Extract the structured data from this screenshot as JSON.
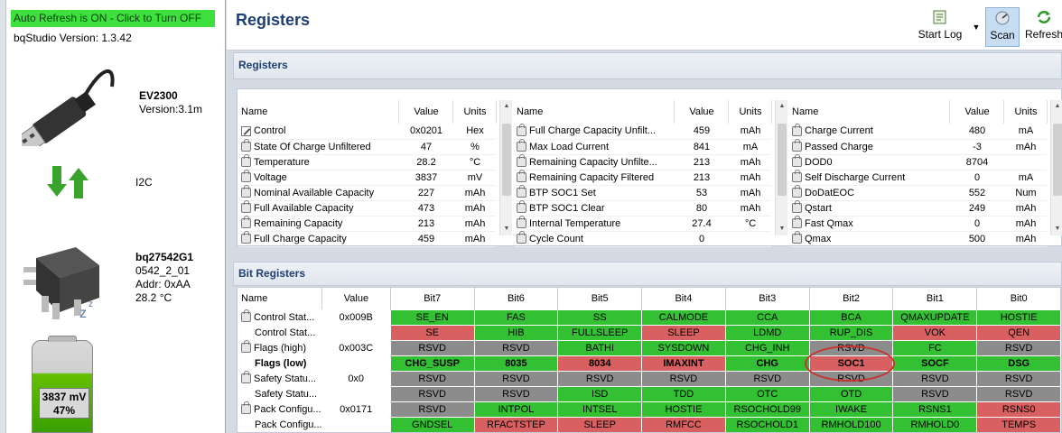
{
  "left_panel": {
    "auto_refresh": "Auto Refresh is ON - Click to Turn OFF",
    "version": "bqStudio Version:  1.3.42",
    "adapter": {
      "name": "EV2300",
      "version": "Version:3.1m"
    },
    "bus": "I2C",
    "device": {
      "name": "bq27542G1",
      "fw": "0542_2_01",
      "addr": "Addr: 0xAA",
      "temp": "28.2 °C"
    },
    "battery": {
      "voltage": "3837 mV",
      "percent": "47%"
    }
  },
  "header": {
    "title": "Registers",
    "start_log": "Start Log",
    "scan": "Scan",
    "refresh": "Refresh"
  },
  "registers": {
    "section_title": "Registers",
    "columns": [
      "Name",
      "Value",
      "Units"
    ],
    "col1": [
      {
        "name": "Control",
        "value": "0x0201",
        "units": "Hex"
      },
      {
        "name": "State Of Charge Unfiltered",
        "value": "47",
        "units": "%"
      },
      {
        "name": "Temperature",
        "value": "28.2",
        "units": "°C"
      },
      {
        "name": "Voltage",
        "value": "3837",
        "units": "mV"
      },
      {
        "name": "Nominal Available Capacity",
        "value": "227",
        "units": "mAh"
      },
      {
        "name": "Full Available Capacity",
        "value": "473",
        "units": "mAh"
      },
      {
        "name": "Remaining Capacity",
        "value": "213",
        "units": "mAh"
      },
      {
        "name": "Full Charge Capacity",
        "value": "459",
        "units": "mAh"
      }
    ],
    "col2": [
      {
        "name": "Full Charge Capacity Unfilt...",
        "value": "459",
        "units": "mAh"
      },
      {
        "name": "Max Load Current",
        "value": "841",
        "units": "mA"
      },
      {
        "name": "Remaining Capacity Unfilte...",
        "value": "213",
        "units": "mAh"
      },
      {
        "name": "Remaining Capacity Filtered",
        "value": "213",
        "units": "mAh"
      },
      {
        "name": "BTP SOC1 Set",
        "value": "53",
        "units": "mAh"
      },
      {
        "name": "BTP SOC1 Clear",
        "value": "80",
        "units": "mAh"
      },
      {
        "name": "Internal Temperature",
        "value": "27.4",
        "units": "°C"
      },
      {
        "name": "Cycle Count",
        "value": "0",
        "units": ""
      }
    ],
    "col3": [
      {
        "name": "Charge Current",
        "value": "480",
        "units": "mA"
      },
      {
        "name": "Passed Charge",
        "value": "-3",
        "units": "mAh"
      },
      {
        "name": "DOD0",
        "value": "8704",
        "units": ""
      },
      {
        "name": "Self Discharge Current",
        "value": "0",
        "units": "mA"
      },
      {
        "name": "DoDatEOC",
        "value": "552",
        "units": "Num"
      },
      {
        "name": "Qstart",
        "value": "249",
        "units": "mAh"
      },
      {
        "name": "Fast Qmax",
        "value": "0",
        "units": "mAh"
      },
      {
        "name": "Qmax",
        "value": "500",
        "units": "mAh"
      }
    ]
  },
  "bit_registers": {
    "section_title": "Bit Registers",
    "columns": [
      "Name",
      "Value",
      "Bit7",
      "Bit6",
      "Bit5",
      "Bit4",
      "Bit3",
      "Bit2",
      "Bit1",
      "Bit0"
    ],
    "rows": [
      {
        "name": "Control Stat...",
        "value": "0x009B",
        "lock": true,
        "bold": false,
        "bits": [
          "SE_EN",
          "FAS",
          "SS",
          "CALMODE",
          "CCA",
          "BCA",
          "QMAXUPDATE",
          "HOSTIE"
        ],
        "colors": [
          "g",
          "g",
          "g",
          "g",
          "g",
          "g",
          "g",
          "g"
        ]
      },
      {
        "name": "Control Stat...",
        "value": "",
        "lock": false,
        "bold": false,
        "bits": [
          "SE",
          "HIB",
          "FULLSLEEP",
          "SLEEP",
          "LDMD",
          "RUP_DIS",
          "VOK",
          "QEN"
        ],
        "colors": [
          "r",
          "g",
          "g",
          "r",
          "g",
          "g",
          "r",
          "r"
        ]
      },
      {
        "name": "Flags (high)",
        "value": "0x003C",
        "lock": true,
        "bold": false,
        "bits": [
          "RSVD",
          "RSVD",
          "BATHI",
          "SYSDOWN",
          "CHG_INH",
          "RSVD",
          "FC",
          "RSVD"
        ],
        "colors": [
          "gr",
          "gr",
          "g",
          "g",
          "g",
          "gr",
          "g",
          "gr"
        ]
      },
      {
        "name": "Flags (low)",
        "value": "",
        "lock": false,
        "bold": true,
        "bits": [
          "CHG_SUSP",
          "8035",
          "8034",
          "IMAXINT",
          "CHG",
          "SOC1",
          "SOCF",
          "DSG"
        ],
        "colors": [
          "g",
          "g",
          "r",
          "r",
          "g",
          "r",
          "g",
          "g"
        ]
      },
      {
        "name": "Safety Statu...",
        "value": "0x0",
        "lock": true,
        "bold": false,
        "bits": [
          "RSVD",
          "RSVD",
          "RSVD",
          "RSVD",
          "RSVD",
          "RSVD",
          "RSVD",
          "RSVD"
        ],
        "colors": [
          "gr",
          "gr",
          "gr",
          "gr",
          "gr",
          "gr",
          "gr",
          "gr"
        ]
      },
      {
        "name": "Safety Statu...",
        "value": "",
        "lock": false,
        "bold": false,
        "bits": [
          "RSVD",
          "RSVD",
          "ISD",
          "TDD",
          "OTC",
          "OTD",
          "RSVD",
          "RSVD"
        ],
        "colors": [
          "gr",
          "gr",
          "g",
          "g",
          "g",
          "g",
          "gr",
          "gr"
        ]
      },
      {
        "name": "Pack Configu...",
        "value": "0x0171",
        "lock": true,
        "bold": false,
        "bits": [
          "RSVD",
          "INTPOL",
          "INTSEL",
          "HOSTIE",
          "RSOCHOLD99",
          "IWAKE",
          "RSNS1",
          "RSNS0"
        ],
        "colors": [
          "gr",
          "g",
          "g",
          "g",
          "g",
          "g",
          "g",
          "r"
        ]
      },
      {
        "name": "Pack Configu...",
        "value": "",
        "lock": false,
        "bold": false,
        "bits": [
          "GNDSEL",
          "RFACTSTEP",
          "SLEEP",
          "RMFCC",
          "RSOCHOLD1",
          "RMHOLD100",
          "RMHOLD0",
          "TEMPS"
        ],
        "colors": [
          "g",
          "r",
          "r",
          "r",
          "g",
          "g",
          "g",
          "r"
        ]
      }
    ]
  }
}
